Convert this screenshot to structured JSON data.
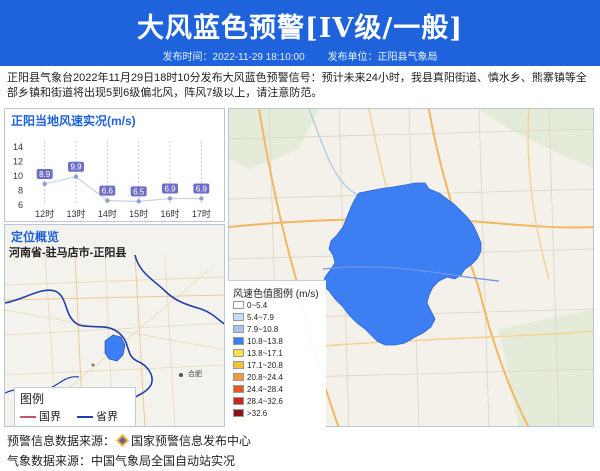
{
  "header": {
    "title": "大风蓝色预警[IV级/一般]",
    "publish_time": "发布时间：2022-11-29 18:10:00",
    "publisher": "发布单位：正阳县气象局",
    "accent_color": "#1f63dc"
  },
  "description": "正阳县气象台2022年11月29日18时10分发布大风蓝色预警信号：预计未来24小时，我县真阳街道、慎水乡、熊寨镇等全部乡镇和街道将出现5到6级偏北风，阵风7级以上，请注意防范。",
  "wind_panel": {
    "title": "正阳当地风速实况(m/s)"
  },
  "chart_data": {
    "type": "line",
    "title": "正阳当地风速实况(m/s)",
    "categories": [
      "12时",
      "13时",
      "14时",
      "15时",
      "16时",
      "17时"
    ],
    "values": [
      8.9,
      9.9,
      6.6,
      6.5,
      6.9,
      6.9
    ],
    "y_ticks": [
      "14",
      "12",
      "10",
      "8",
      "6"
    ],
    "ylim": [
      6,
      14
    ],
    "grid": "vertical dashed",
    "label_color": "#6d6fc7"
  },
  "locator": {
    "title": "定位概览",
    "subtitle": "河南省-驻马店市-正阳县",
    "legend_title": "图例",
    "legend_items": [
      {
        "label": "国界",
        "color": "#c7576e"
      },
      {
        "label": "省界",
        "color": "#1f3fae"
      }
    ],
    "city_label": "合肥"
  },
  "warning_map": {
    "fill_color": "#3d7ef2",
    "scale_title": "风速色值图例 (m/s)",
    "scale": [
      {
        "label": "0~5.4",
        "color": "#ffffff"
      },
      {
        "label": "5.4~7.9",
        "color": "#c9dcf7"
      },
      {
        "label": "7.9~10.8",
        "color": "#a6c4f3"
      },
      {
        "label": "10.8~13.8",
        "color": "#3d7ef2"
      },
      {
        "label": "13.8~17.1",
        "color": "#f5e14a"
      },
      {
        "label": "17.1~20.8",
        "color": "#f1c232"
      },
      {
        "label": "20.8~24.4",
        "color": "#f19a3e"
      },
      {
        "label": "24.4~28.4",
        "color": "#e55a1f"
      },
      {
        "label": "28.4~32.6",
        "color": "#c6281f"
      },
      {
        "label": ">32.6",
        "color": "#8a1414"
      }
    ]
  },
  "sources": {
    "warning_source": "预警信息数据来源：",
    "warning_source_name": "国家预警信息发布中心",
    "weather_source": "气象数据来源：中国气象局全国自动站实况"
  }
}
